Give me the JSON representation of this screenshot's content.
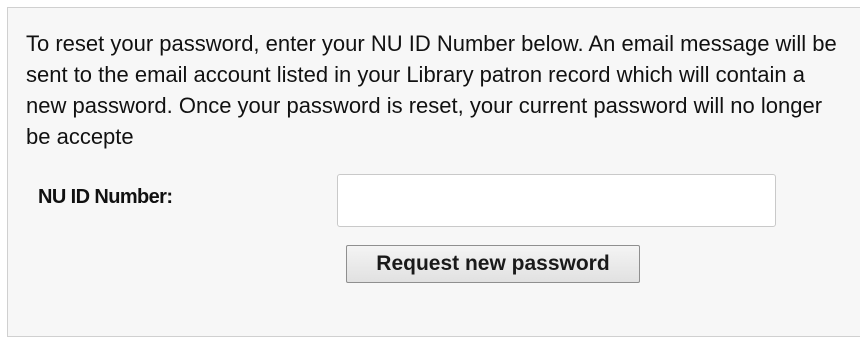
{
  "reset_form": {
    "instructions": "To reset your password, enter your NU ID Number below. An email message will be sent to the email account listed in your Library patron record which will contain a new password. Once your password is reset, your current password will no longer be accepte",
    "id_label": "NU ID Number:",
    "id_value": "",
    "id_placeholder": "",
    "submit_label": "Request new password"
  }
}
